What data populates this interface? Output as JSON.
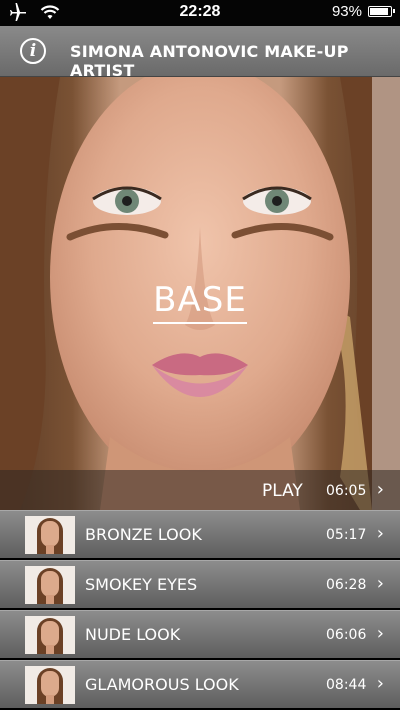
{
  "status_bar": {
    "time": "22:28",
    "battery": "93%",
    "battery_level": 0.93
  },
  "header": {
    "info_icon": "i",
    "title": "SIMONA ANTONOVIC MAKE-UP ARTIST"
  },
  "hero": {
    "title": "BASE"
  },
  "play_bar": {
    "label": "PLAY",
    "duration": "06:05",
    "chevron": "›"
  },
  "looks": [
    {
      "label": "BRONZE LOOK",
      "duration": "05:17",
      "chevron": "›"
    },
    {
      "label": "SMOKEY EYES",
      "duration": "06:28",
      "chevron": "›"
    },
    {
      "label": "NUDE LOOK",
      "duration": "06:06",
      "chevron": "›"
    },
    {
      "label": "GLAMOROUS LOOK",
      "duration": "08:44",
      "chevron": "›"
    }
  ]
}
